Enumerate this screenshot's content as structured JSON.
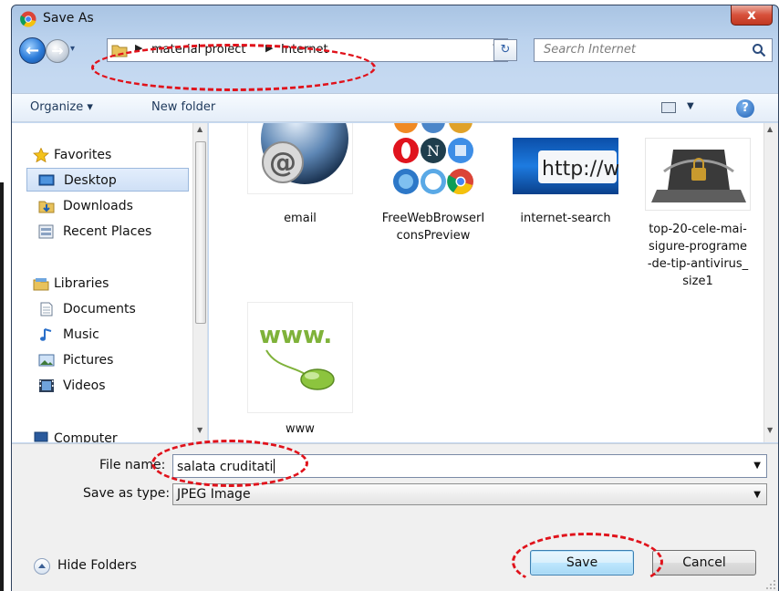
{
  "window": {
    "title": "Save As",
    "close_glyph": "x"
  },
  "navigation": {
    "back_glyph": "←",
    "forward_glyph": "→",
    "path": [
      "material proiect",
      "Internet"
    ],
    "search_placeholder": "Search Internet"
  },
  "toolbar": {
    "organize_label": "Organize ▾",
    "new_folder_label": "New folder",
    "help_glyph": "?"
  },
  "sidebar": {
    "items": [
      {
        "label": "Favorites",
        "icon": "star-icon"
      },
      {
        "label": "Desktop",
        "icon": "desktop-icon",
        "selected": true
      },
      {
        "label": "Downloads",
        "icon": "downloads-icon"
      },
      {
        "label": "Recent Places",
        "icon": "recent-places-icon"
      },
      {
        "label": "Libraries",
        "icon": "libraries-icon"
      },
      {
        "label": "Documents",
        "icon": "documents-icon"
      },
      {
        "label": "Music",
        "icon": "music-icon"
      },
      {
        "label": "Pictures",
        "icon": "pictures-icon"
      },
      {
        "label": "Videos",
        "icon": "videos-icon"
      },
      {
        "label": "Computer",
        "icon": "computer-icon"
      }
    ]
  },
  "files": [
    {
      "name": "email"
    },
    {
      "name": "FreeWebBrowserIconsPreview",
      "lines": [
        "FreeWebBrowserI",
        "consPreview"
      ]
    },
    {
      "name": "internet-search",
      "thumb_text": "http://www"
    },
    {
      "name": "top-20-cele-mai-sigure-programe-de-tip-antivirus_size1",
      "lines": [
        "top-20-cele-mai-",
        "sigure-programe",
        "-de-tip-antivirus_",
        "size1"
      ]
    },
    {
      "name": "www",
      "thumb_text": "www."
    }
  ],
  "form": {
    "file_name_label": "File name:",
    "file_name_value": "salata cruditati",
    "save_type_label": "Save as type:",
    "save_type_value": "JPEG Image"
  },
  "footer": {
    "hide_folders_label": "Hide Folders",
    "save_label": "Save",
    "cancel_label": "Cancel"
  },
  "colors": {
    "callout": "#e0121b",
    "accent": "#3c7fb1"
  }
}
